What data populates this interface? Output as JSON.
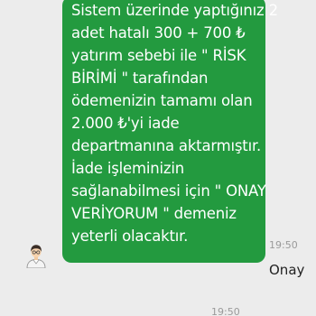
{
  "incoming_message": {
    "lines": [
      "Sistem üzerinde yaptığınız 2",
      "adet hatalı 300 + 700 ₺",
      "yatırım sebebi ile \" RİSK",
      "BİRİMİ \" tarafından",
      "ödemenizin tamamı olan",
      "2.000 ₺'yi iade",
      "departmanına aktarmıştır.",
      "İade işleminizin",
      "sağlanabilmesi için \" ONAY",
      "VERİYORUM \" demeniz",
      "yeterli olacaktır."
    ],
    "time": "19:50",
    "bubble_color": "#239a3f"
  },
  "outgoing_message": {
    "text": "Onay",
    "time": "19:50"
  },
  "sender_avatar": {
    "icon": "person-avatar-icon"
  }
}
